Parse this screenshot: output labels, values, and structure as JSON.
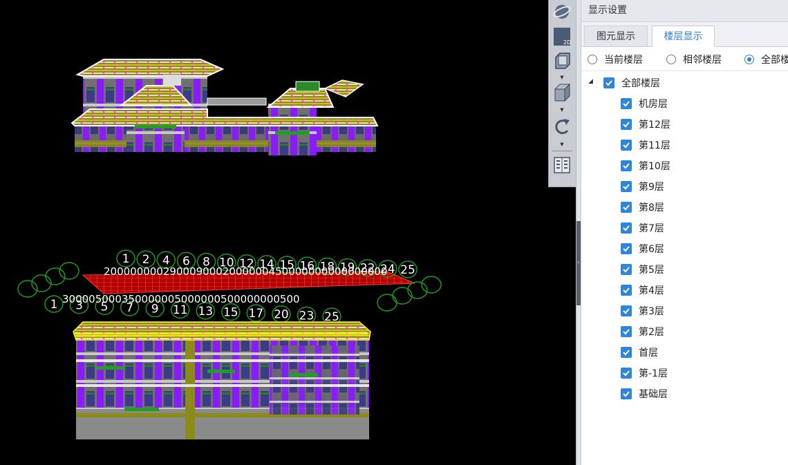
{
  "panel": {
    "title": "显示设置",
    "tabs": [
      {
        "label": "图元显示",
        "active": false
      },
      {
        "label": "楼层显示",
        "active": true
      }
    ],
    "radios": [
      {
        "label": "当前楼层",
        "selected": false
      },
      {
        "label": "相邻楼层",
        "selected": false
      },
      {
        "label": "全部楼",
        "selected": true
      }
    ],
    "tree": {
      "root": {
        "label": "全部楼层",
        "checked": true,
        "expanded": true
      },
      "floors": [
        {
          "label": "机房层",
          "checked": true
        },
        {
          "label": "第12层",
          "checked": true
        },
        {
          "label": "第11层",
          "checked": true
        },
        {
          "label": "第10层",
          "checked": true
        },
        {
          "label": "第9层",
          "checked": true
        },
        {
          "label": "第8层",
          "checked": true
        },
        {
          "label": "第7层",
          "checked": true
        },
        {
          "label": "第6层",
          "checked": true
        },
        {
          "label": "第5层",
          "checked": true
        },
        {
          "label": "第4层",
          "checked": true
        },
        {
          "label": "第3层",
          "checked": true
        },
        {
          "label": "第2层",
          "checked": true
        },
        {
          "label": "首层",
          "checked": true
        },
        {
          "label": "第-1层",
          "checked": true
        },
        {
          "label": "基础层",
          "checked": true
        }
      ]
    }
  },
  "toolbar": {
    "buttons": [
      {
        "icon": "globe-orbit-icon"
      },
      {
        "icon": "view-2d-icon",
        "label": "2D"
      },
      {
        "icon": "cube-wireframe-icon"
      },
      {
        "icon": "cube-solid-icon"
      },
      {
        "icon": "rotate-icon"
      },
      {
        "icon": "floor-settings-icon"
      }
    ]
  },
  "viewport": {
    "axis_labels_top": [
      "1",
      "2",
      "4",
      "6",
      "8",
      "10",
      "12",
      "14",
      "15",
      "16",
      "18",
      "19",
      "22",
      "24",
      "25"
    ],
    "axis_labels_bottom": [
      "1",
      "3",
      "5",
      "7",
      "9",
      "11",
      "13",
      "15",
      "17",
      "20",
      "23",
      "25"
    ],
    "dimension_text_top": "2000000002900090002000000450000000000000000",
    "dimension_text_bottom": "300005000350000005000000500000000500",
    "colors": {
      "wall": "#8a1bff",
      "slab": "#8c8a18",
      "roof_lines": "#ffffff",
      "beam": "#ff40c8",
      "axis_circle": "#1f9a1f",
      "grid": "#ff1a1a",
      "yellow": "#ffff00"
    }
  }
}
